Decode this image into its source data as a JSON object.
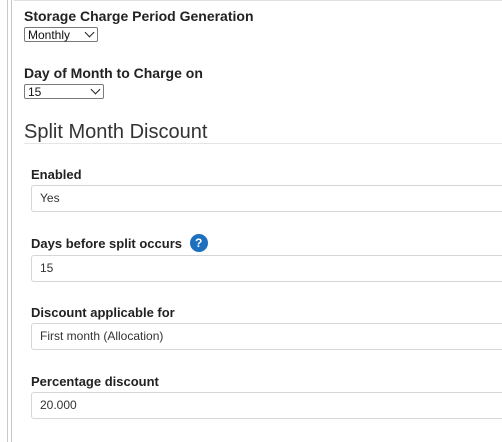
{
  "storage": {
    "period_label": "Storage Charge Period Generation",
    "period_value": "Monthly",
    "day_label": "Day of Month to Charge on",
    "day_value": "15"
  },
  "split_month": {
    "title": "Split Month Discount",
    "enabled_label": "Enabled",
    "enabled_value": "Yes",
    "days_label": "Days before split occurs",
    "days_help_icon": "?",
    "days_value": "15",
    "applicable_label": "Discount applicable for",
    "applicable_value": "First month (Allocation)",
    "percentage_label": "Percentage discount",
    "percentage_value": "20.000"
  }
}
